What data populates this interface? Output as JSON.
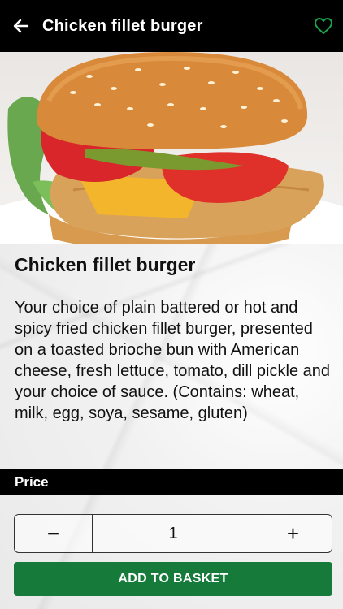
{
  "header": {
    "title": "Chicken fillet burger",
    "back_icon": "arrow-left-icon",
    "favorite_icon": "heart-outline-icon",
    "favorite_color": "#1aa34a"
  },
  "product": {
    "name": "Chicken fillet burger",
    "description": "Your choice of plain battered or hot and spicy fried chicken fillet burger, presented on a toasted brioche bun with American cheese, fresh lettuce, tomato, dill pickle and your choice of sauce. (Contains: wheat, milk, egg, soya, sesame, gluten)"
  },
  "price": {
    "label": "Price"
  },
  "quantity": {
    "decrement": "−",
    "value": "1",
    "increment": "+"
  },
  "actions": {
    "add_to_basket": "ADD TO BASKET",
    "button_color": "#157a3a"
  }
}
